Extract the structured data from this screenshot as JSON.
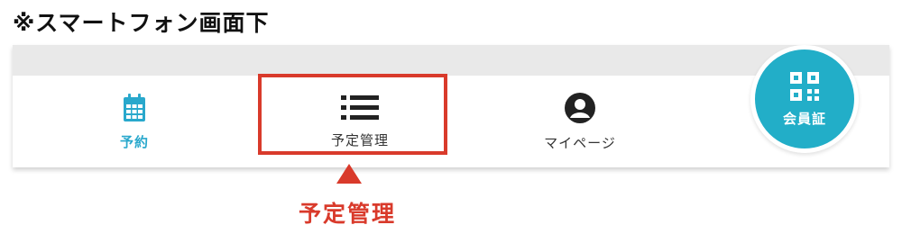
{
  "caption": "※スマートフォン画面下",
  "colors": {
    "accent": "#29a8cc",
    "member_button": "#22aec8",
    "highlight": "#d93a2b",
    "text": "#333333",
    "header_gray": "#e9e9e9"
  },
  "nav": {
    "items": [
      {
        "label": "予約",
        "icon": "calendar-icon",
        "active": true
      },
      {
        "label": "予定管理",
        "icon": "list-icon",
        "active": false
      },
      {
        "label": "マイページ",
        "icon": "user-icon",
        "active": false
      }
    ],
    "member": {
      "label": "会員証",
      "icon": "qr-code-icon"
    }
  },
  "annotation": {
    "label": "予定管理"
  }
}
